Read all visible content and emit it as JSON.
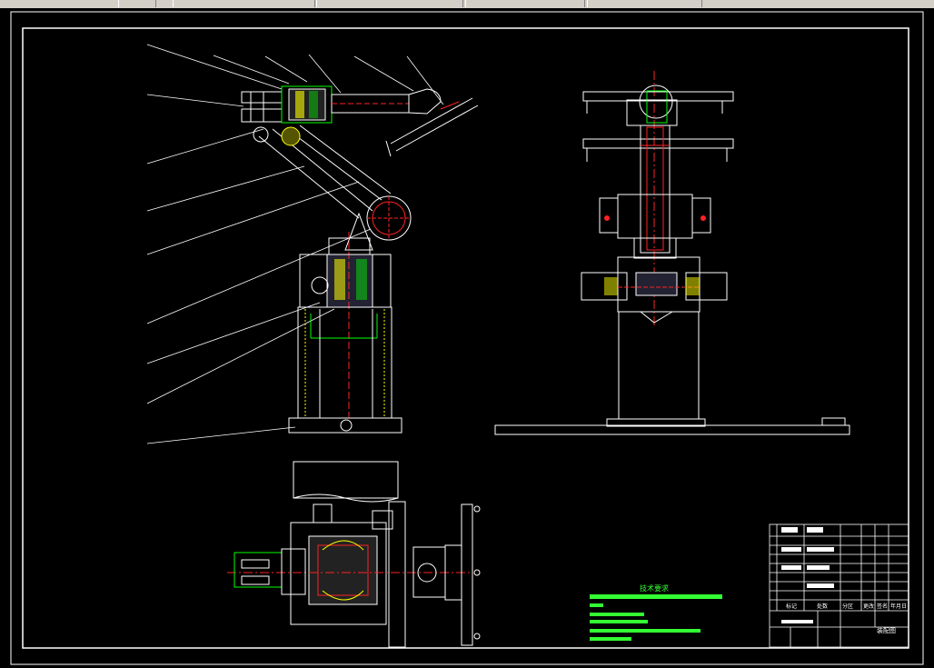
{
  "toolbar": {
    "items": [
      "",
      "",
      "",
      "",
      ""
    ]
  },
  "drawing": {
    "tech_requirements_title": "技术要求",
    "title_block_name": "装配图",
    "title_block_labels": [
      "标记",
      "处数",
      "分区",
      "更改",
      "签名",
      "年月日"
    ],
    "colors": {
      "background": "#000000",
      "line": "#ffffff",
      "center": "#ff2a2a",
      "dimension": "#00ff00",
      "hatch": "#ffff00",
      "text_bars": "#33ff33"
    }
  }
}
